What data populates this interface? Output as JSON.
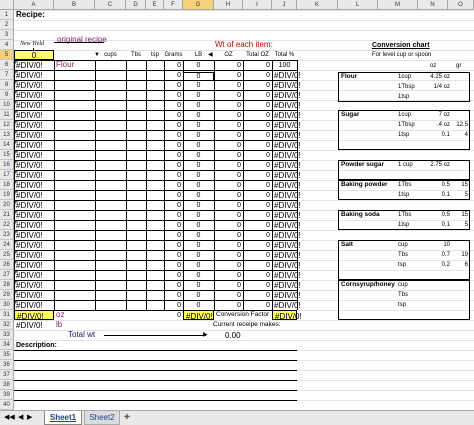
{
  "columns": [
    "A",
    "B",
    "C",
    "D",
    "E",
    "F",
    "G",
    "H",
    "I",
    "J",
    "K",
    "L",
    "M",
    "N",
    "O"
  ],
  "rows": [
    "1",
    "2",
    "3",
    "4",
    "5",
    "6",
    "7",
    "8",
    "9",
    "10",
    "11",
    "12",
    "13",
    "14",
    "15",
    "16",
    "17",
    "18",
    "19",
    "20",
    "21",
    "22",
    "23",
    "24",
    "25",
    "26",
    "27",
    "28",
    "29",
    "30",
    "31",
    "32",
    "33",
    "34",
    "35",
    "36",
    "37",
    "38",
    "39",
    "40"
  ],
  "sheet": {
    "recipe_label": "Recipe:",
    "new_yield_label": "New Yield",
    "yield_value": "0",
    "original_recipe_label": "original recipe",
    "wt_each_item_label": "Wt of each item:",
    "col_headers": [
      "cups",
      "Tbs",
      "tsp",
      "Grams",
      "LB",
      "OZ",
      "Total OZ",
      "Total %"
    ],
    "first_ingredient": "Flour",
    "error_value": "#DIV/0!",
    "zero": "0",
    "hundred": "100",
    "oz_label": "oz",
    "lb_label": "lb",
    "conversion_factor_label": "Conversion Factor",
    "current_recipe_makes": "Current receipe makes:",
    "current_value": "0.00",
    "total_wt_label": "Total wt",
    "description_label": "Description:"
  },
  "conversion": {
    "title": "Conversion chart",
    "subtitle": "For level cup or spoon",
    "col_oz": "oz",
    "col_gr": "gr",
    "flour": {
      "name": "Flour",
      "rows": [
        [
          "1cup",
          "4.25 oz",
          ""
        ],
        [
          "1Tbsp",
          "1/4 oz",
          ""
        ],
        [
          "1tsp",
          "",
          ""
        ]
      ]
    },
    "sugar": {
      "name": "Sugar",
      "rows": [
        [
          "1cup",
          "7 oz",
          ""
        ],
        [
          "1Tbsp",
          ".4 oz",
          "12.5"
        ],
        [
          "1tsp",
          "0.1",
          "4"
        ]
      ]
    },
    "powder_sugar": {
      "name": "Powder sugar",
      "rows": [
        [
          "1 cup",
          "2.75 oz",
          ""
        ]
      ]
    },
    "baking_powder": {
      "name": "Baking powder",
      "rows": [
        [
          "1Tbs",
          "0.5",
          "15"
        ],
        [
          "1tsp",
          "0.1",
          "5"
        ]
      ]
    },
    "baking_soda": {
      "name": "Baking soda",
      "rows": [
        [
          "1Tbs",
          "0.5",
          "15"
        ],
        [
          "1tsp",
          "0.1",
          "5"
        ]
      ]
    },
    "salt": {
      "name": "Salt",
      "rows": [
        [
          "cup",
          "10",
          ""
        ],
        [
          "Tbs",
          "0.7",
          "19"
        ],
        [
          "tsp",
          "0.2",
          "6"
        ]
      ]
    },
    "cornsyrup": {
      "name": "Cornsyrup/honey",
      "rows": [
        [
          "cup",
          "",
          ""
        ],
        [
          "Tbs",
          "",
          ""
        ],
        [
          "tsp",
          "",
          ""
        ]
      ]
    }
  },
  "tabs": [
    "Sheet1",
    "Sheet2"
  ],
  "colors": {
    "yellow": "#ffff66",
    "error_green": "#2e7d32",
    "header_gray": "#e9e9e9",
    "purple": "#7a1f6a",
    "red": "#c00000"
  }
}
